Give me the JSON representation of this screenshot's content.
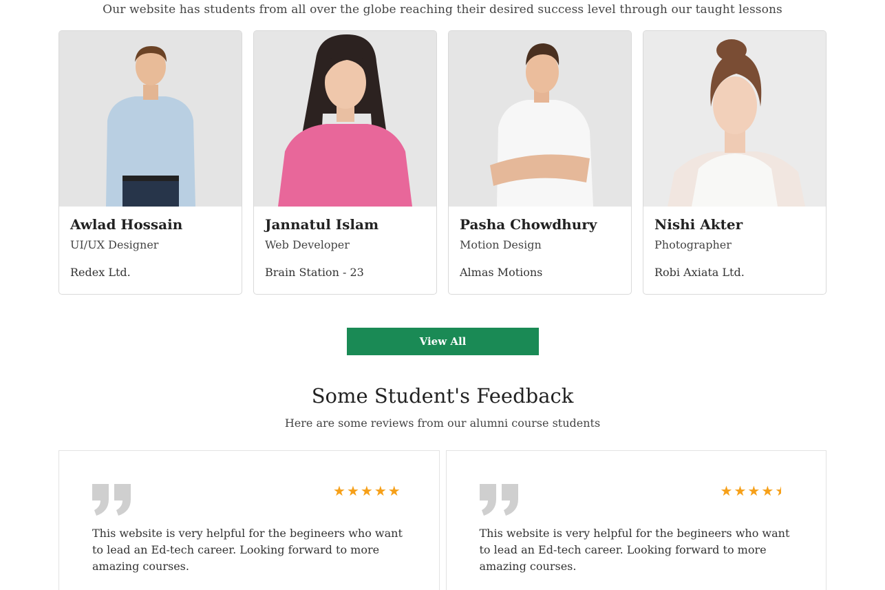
{
  "intro": "Our website has students from all over the globe reaching their desired success level through our taught lessons",
  "students": [
    {
      "name": "Awlad Hossain",
      "role": "UI/UX Designer",
      "company": "Redex Ltd."
    },
    {
      "name": "Jannatul Islam",
      "role": "Web Developer",
      "company": "Brain Station - 23"
    },
    {
      "name": "Pasha Chowdhury",
      "role": "Motion Design",
      "company": "Almas Motions"
    },
    {
      "name": "Nishi Akter",
      "role": "Photographer",
      "company": "Robi Axiata Ltd."
    }
  ],
  "view_all_label": "View All",
  "feedback": {
    "title": "Some Student's Feedback",
    "subtitle": "Here are some reviews from our alumni course students",
    "reviews": [
      {
        "rating": 5,
        "text": "This website is very helpful for the begineers who want to lead an Ed-tech career. Looking forward to more amazing courses."
      },
      {
        "rating": 4.5,
        "text": "This website is very helpful for the begineers who want to lead an Ed-tech career. Looking forward to more amazing courses."
      }
    ]
  },
  "colors": {
    "accent": "#1a8a55",
    "star": "#f6a019",
    "quote": "#cfcfcf"
  }
}
